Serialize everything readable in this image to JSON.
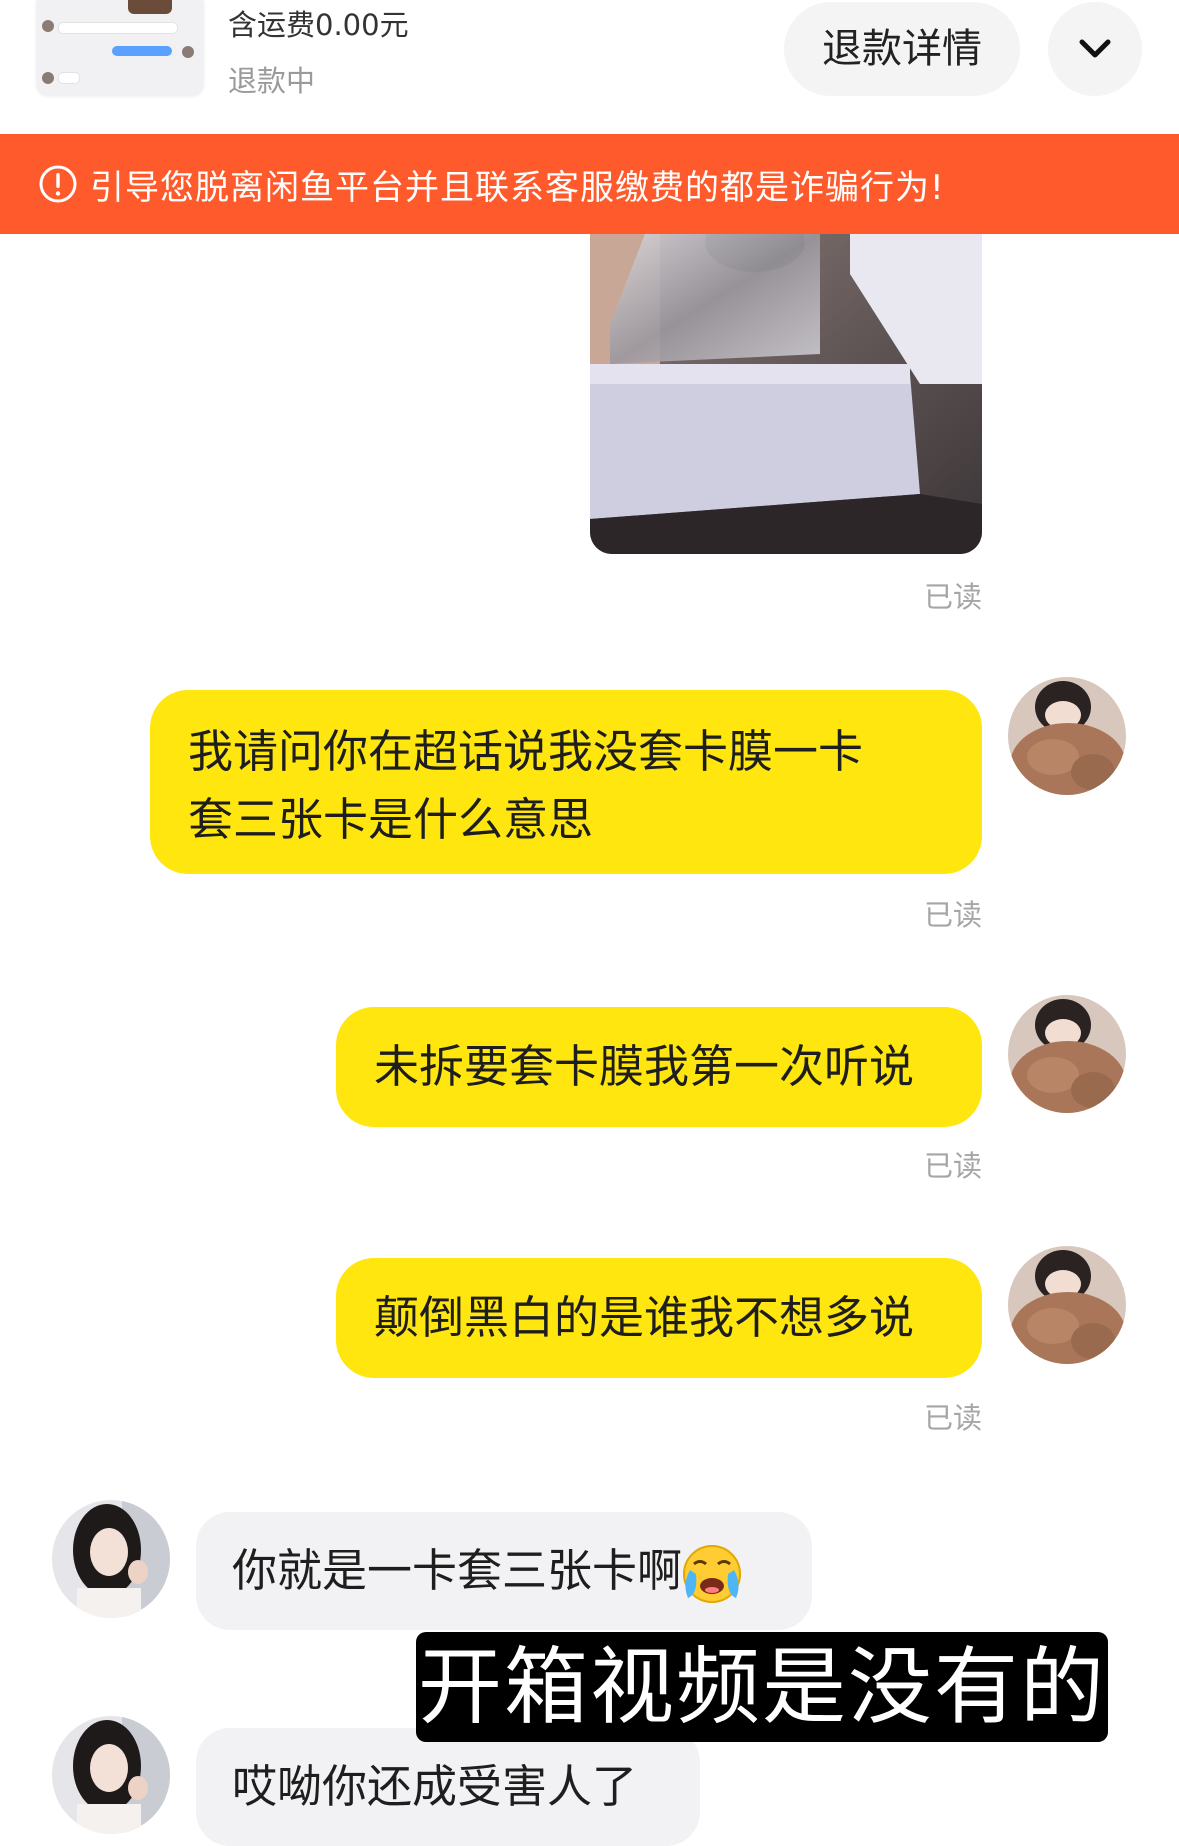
{
  "order": {
    "price_text": "含运费0.00元",
    "status_text": "退款中",
    "refund_button_label": "退款详情",
    "expand_icon": "chevron-down-icon"
  },
  "warning": {
    "text": "引导您脱离闲鱼平台并且联系客服缴费的都是诈骗行为!",
    "icon": "alert-circle-icon",
    "color": "#ff5a2c"
  },
  "messages": [
    {
      "side": "me",
      "type": "image",
      "read_status": "已读"
    },
    {
      "side": "me",
      "type": "text",
      "lines": [
        "我请问你在超话说我没套卡膜一卡",
        "套三张卡是什么意思"
      ],
      "read_status": "已读"
    },
    {
      "side": "me",
      "type": "text",
      "text": "未拆要套卡膜我第一次听说",
      "read_status": "已读"
    },
    {
      "side": "me",
      "type": "text",
      "text": "颠倒黑白的是谁我不想多说",
      "read_status": "已读"
    },
    {
      "side": "them",
      "type": "text",
      "text": "你就是一卡套三张卡啊",
      "emoji": "crying-face-icon"
    },
    {
      "side": "them",
      "type": "text",
      "text": "哎呦你还成受害人了"
    }
  ],
  "colors": {
    "my_bubble": "#ffe60f",
    "their_bubble": "#f2f2f4",
    "read_text": "#a6a6a6"
  },
  "overlay": {
    "subtitle": "开箱视频是没有的"
  }
}
